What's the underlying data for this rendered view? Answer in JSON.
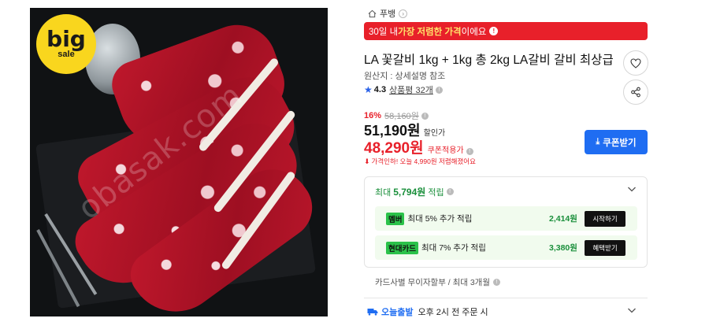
{
  "image": {
    "badge_big": "big",
    "badge_sale": "sale",
    "watermark": "obasak.com"
  },
  "breadcrumb": {
    "brand": "푸뱅",
    "icon": "home-icon"
  },
  "lowest_bar": {
    "prefix": "30일 내 ",
    "highlight": "가장 저렴한 가격",
    "suffix": "이에요",
    "info": "!"
  },
  "product": {
    "title": "LA 꽃갈비 1kg + 1kg 총 2kg LA갈비 갈비 최상급",
    "origin": "원산지 : 상세설명 참조",
    "rating": "4.3",
    "reviews": "상품평 32개"
  },
  "price": {
    "discount_pct": "16%",
    "original": "58,160원",
    "sale_price": "51,190원",
    "sale_label": "할인가",
    "coupon_price": "48,290원",
    "coupon_label": "쿠폰적용가",
    "drop_note": "가격인하! 오늘 4,990원 저렴해졌어요"
  },
  "coupon_button": {
    "label": "쿠폰받기"
  },
  "rewards": {
    "head_prefix": "최대",
    "head_amount": "5,794원",
    "head_suffix": "적립",
    "items": [
      {
        "tag": "멤버",
        "text": "최대 5% 추가 적립",
        "amount": "2,414원",
        "action": "시작하기"
      },
      {
        "tag": "현대카드",
        "text": "최대 7% 추가 적립",
        "amount": "3,380원",
        "action": "혜택받기"
      }
    ]
  },
  "installment": {
    "text": "카드사별 무이자할부 / 최대 3개월"
  },
  "shipping": {
    "label": "오늘출발",
    "text": "오후 2시 전 주문 시"
  },
  "colors": {
    "accent_red": "#e8202a",
    "accent_blue": "#1f6df2",
    "reward_green": "#1a8f3b"
  }
}
